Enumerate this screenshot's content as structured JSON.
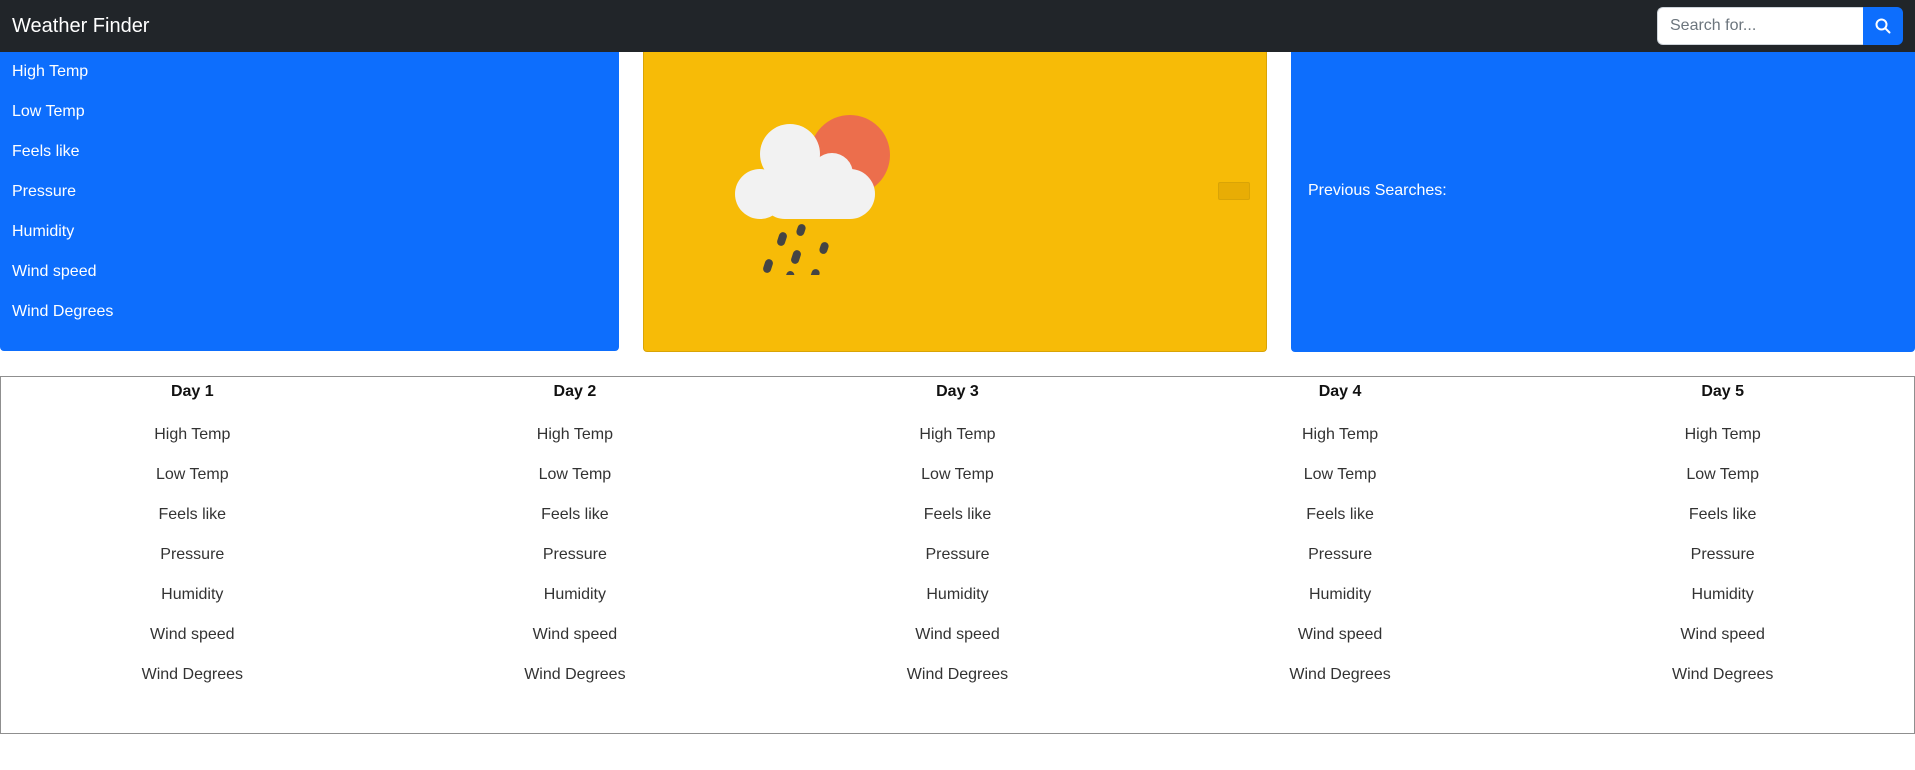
{
  "navbar": {
    "brand": "Weather Finder",
    "search_placeholder": "Search for...",
    "search_icon": "search-icon"
  },
  "current": {
    "stats": [
      "High Temp",
      "Low Temp",
      "Feels like",
      "Pressure",
      "Humidity",
      "Wind speed",
      "Wind Degrees"
    ]
  },
  "weather_card": {
    "icon": "cloud-sun-rain-icon",
    "colors": {
      "background": "#f7bb07",
      "sun": "#ec6e4c",
      "cloud": "#f2f2f2",
      "rain": "#444444"
    }
  },
  "history": {
    "label": "Previous Searches:"
  },
  "forecast": {
    "days": [
      {
        "title": "Day 1",
        "stats": [
          "High Temp",
          "Low Temp",
          "Feels like",
          "Pressure",
          "Humidity",
          "Wind speed",
          "Wind Degrees"
        ]
      },
      {
        "title": "Day 2",
        "stats": [
          "High Temp",
          "Low Temp",
          "Feels like",
          "Pressure",
          "Humidity",
          "Wind speed",
          "Wind Degrees"
        ]
      },
      {
        "title": "Day 3",
        "stats": [
          "High Temp",
          "Low Temp",
          "Feels like",
          "Pressure",
          "Humidity",
          "Wind speed",
          "Wind Degrees"
        ]
      },
      {
        "title": "Day 4",
        "stats": [
          "High Temp",
          "Low Temp",
          "Feels like",
          "Pressure",
          "Humidity",
          "Wind speed",
          "Wind Degrees"
        ]
      },
      {
        "title": "Day 5",
        "stats": [
          "High Temp",
          "Low Temp",
          "Feels like",
          "Pressure",
          "Humidity",
          "Wind speed",
          "Wind Degrees"
        ]
      }
    ]
  },
  "colors": {
    "primary": "#0d6efd",
    "navbar": "#212529",
    "warning": "#f7bb07"
  }
}
